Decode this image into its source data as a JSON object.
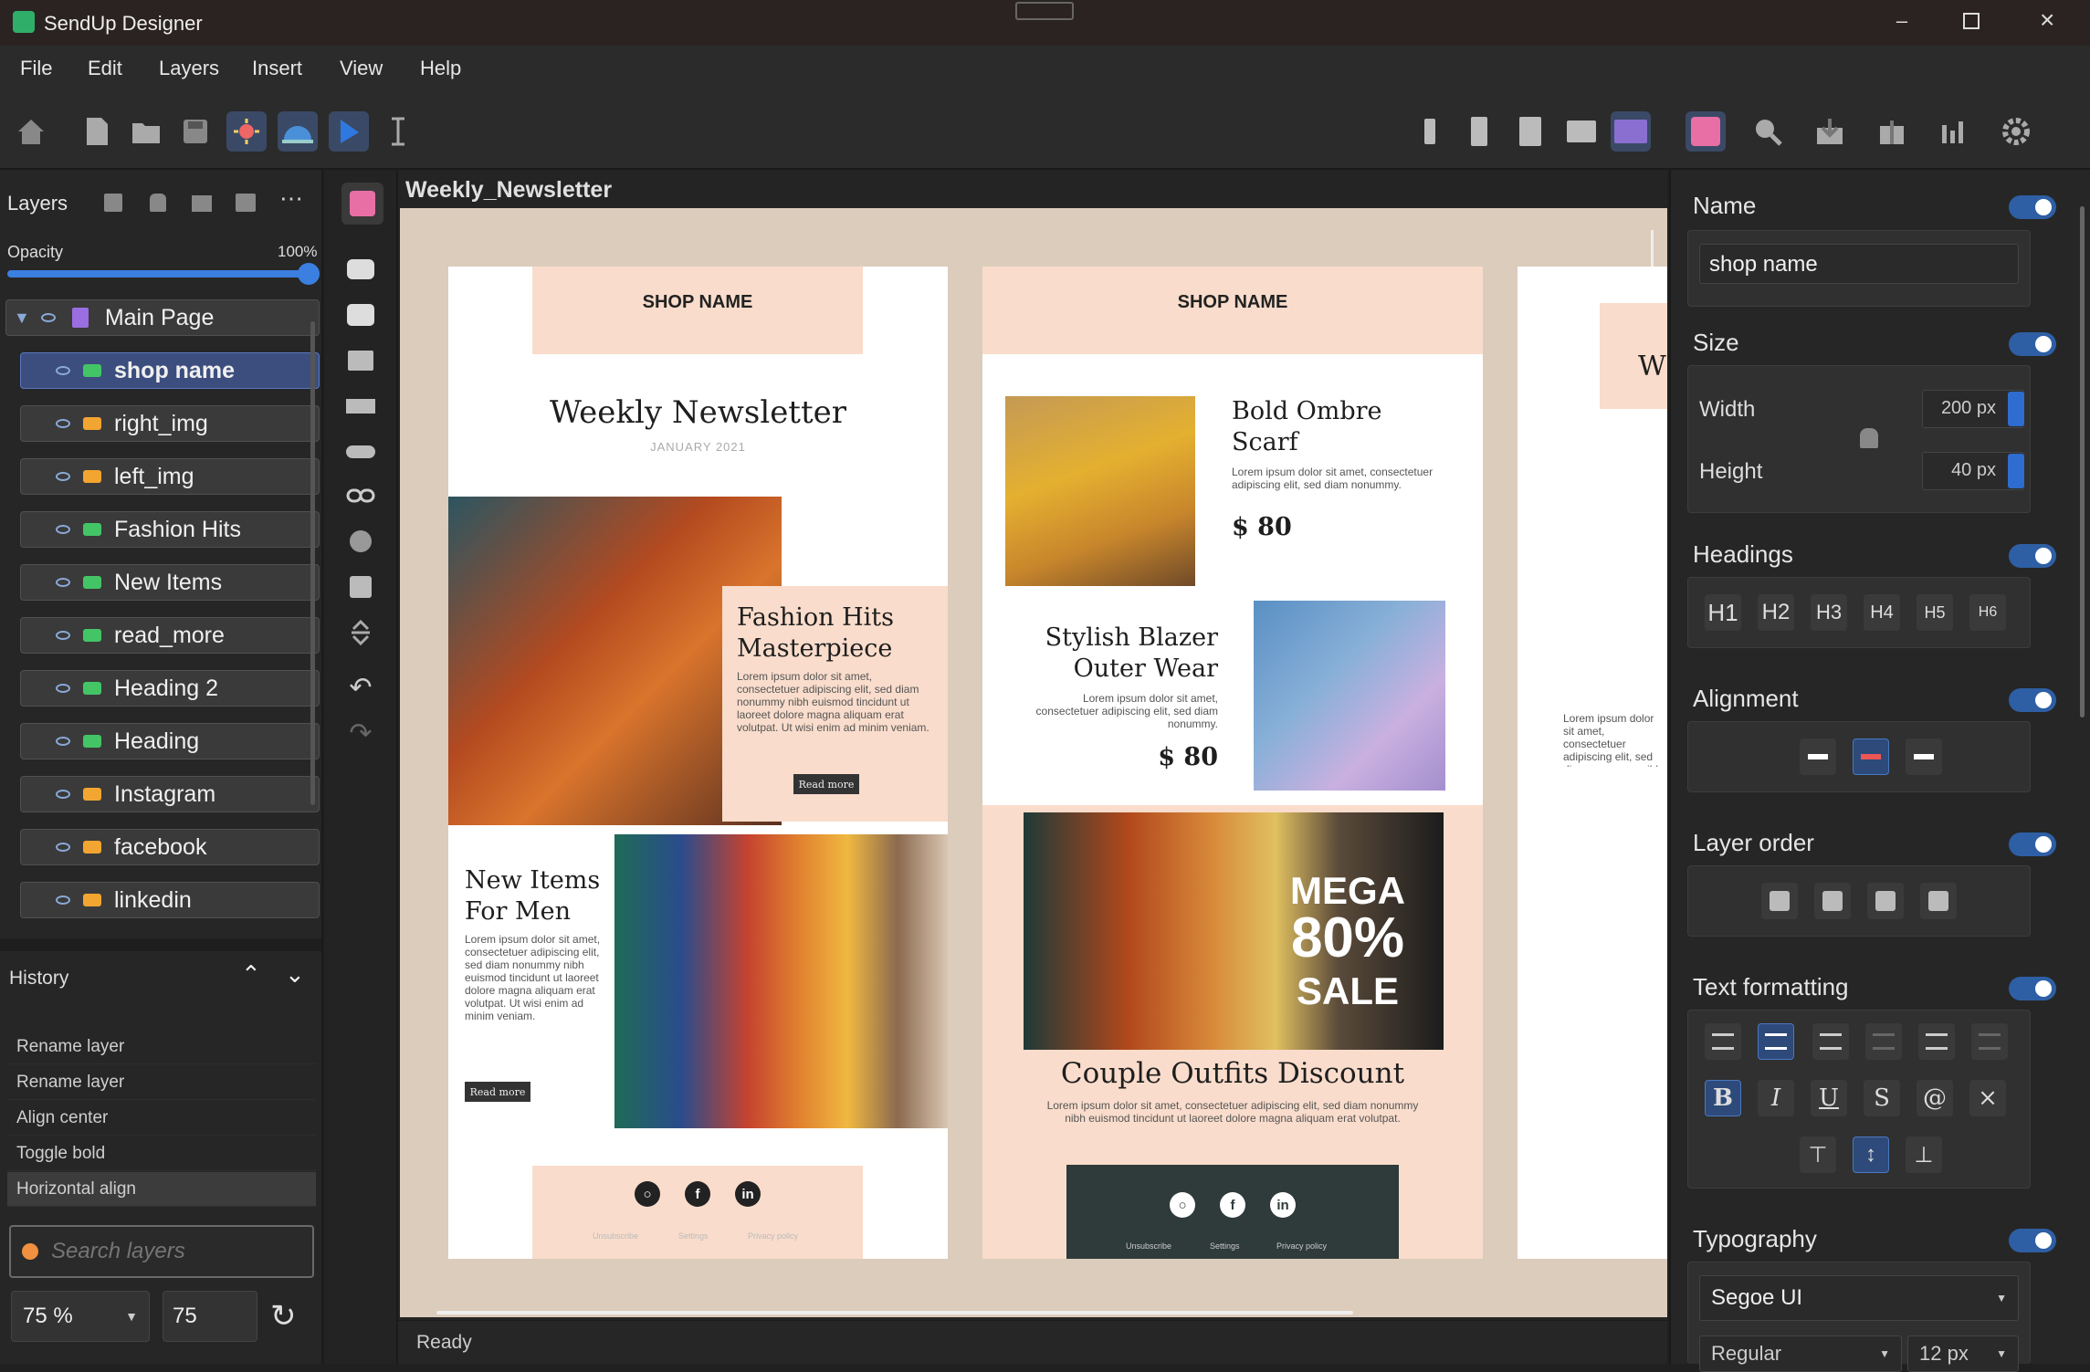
{
  "app": {
    "title": "SendUp Designer"
  },
  "menu": [
    "File",
    "Edit",
    "Layers",
    "Insert",
    "View",
    "Help"
  ],
  "layers_panel": {
    "title": "Layers",
    "opacity_label": "Opacity",
    "opacity_value": "100%",
    "opacity": 1.0,
    "root": "Main Page",
    "items": [
      {
        "label": "shop name",
        "kind": "text",
        "selected": true
      },
      {
        "label": "right_img",
        "kind": "img"
      },
      {
        "label": "left_img",
        "kind": "img"
      },
      {
        "label": "Fashion Hits",
        "kind": "text"
      },
      {
        "label": "New Items",
        "kind": "text"
      },
      {
        "label": "read_more",
        "kind": "text"
      },
      {
        "label": "Heading 2",
        "kind": "text"
      },
      {
        "label": "Heading",
        "kind": "text"
      },
      {
        "label": "Instagram",
        "kind": "img"
      },
      {
        "label": "facebook",
        "kind": "img"
      },
      {
        "label": "linkedin",
        "kind": "img"
      }
    ]
  },
  "history": {
    "title": "History",
    "items": [
      "Rename layer",
      "Rename layer",
      "Align center",
      "Toggle bold",
      "Horizontal align"
    ]
  },
  "search": {
    "placeholder": "Search layers"
  },
  "zoom": {
    "select": "75 %",
    "value": "75"
  },
  "document": {
    "title": "Weekly_Newsletter"
  },
  "status": {
    "text": "Ready"
  },
  "props": {
    "name": {
      "title": "Name",
      "value": "shop name"
    },
    "size": {
      "title": "Size",
      "width_label": "Width",
      "width": "200 px",
      "height_label": "Height",
      "height": "40 px"
    },
    "headings": {
      "title": "Headings",
      "items": [
        "H1",
        "H2",
        "H3",
        "H4",
        "H5",
        "H6"
      ]
    },
    "alignment": {
      "title": "Alignment"
    },
    "layer_order": {
      "title": "Layer order"
    },
    "text_formatting": {
      "title": "Text formatting",
      "styles": [
        "B",
        "I",
        "U",
        "S",
        "@",
        "×"
      ]
    },
    "typography": {
      "title": "Typography",
      "font": "Segoe UI",
      "weight": "Regular",
      "size": "12 px"
    }
  },
  "newsletter": {
    "shop": "SHOP NAME",
    "p1": {
      "title": "Weekly Newsletter",
      "date": "JANUARY 2021",
      "fh_title": "Fashion Hits Masterpiece",
      "fh_body": "Lorem ipsum dolor sit amet, consectetuer adipiscing elit, sed diam nonummy nibh euismod tincidunt ut laoreet dolore magna aliquam erat volutpat. Ut wisi enim ad minim veniam.",
      "read_more": "Read more",
      "ni_title": "New Items For Men",
      "ni_body": "Lorem ipsum dolor sit amet, consectetuer adipiscing elit, sed diam nonummy nibh euismod tincidunt ut laoreet dolore magna aliquam erat volutpat. Ut wisi enim ad minim veniam.",
      "footer": [
        "Unsubscribe",
        "Settings",
        "Privacy policy"
      ]
    },
    "p2": {
      "item1_title": "Bold Ombre Scarf",
      "item1_body": "Lorem ipsum dolor sit amet, consectetuer adipiscing elit, sed diam nonummy.",
      "item1_price": "$ 80",
      "item2_title": "Stylish Blazer Outer Wear",
      "item2_body": "Lorem ipsum dolor sit amet, consectetuer adipiscing elit, sed diam nonummy.",
      "item2_price": "$ 80",
      "mega": "MEGA",
      "pct": "80%",
      "sale": "SALE",
      "co_title": "Couple Outfits Discount",
      "co_body": "Lorem ipsum dolor sit amet, consectetuer adipiscing elit, sed diam nonummy nibh euismod tincidunt ut laoreet dolore magna aliquam erat volutpat.",
      "footer": [
        "Unsubscribe",
        "Settings",
        "Privacy policy"
      ]
    },
    "p3": {
      "w": "W",
      "body": "Lorem ipsum dolor sit amet, consectetuer adipiscing elit, sed diam nonummy nibh euismod tincidunt"
    }
  }
}
